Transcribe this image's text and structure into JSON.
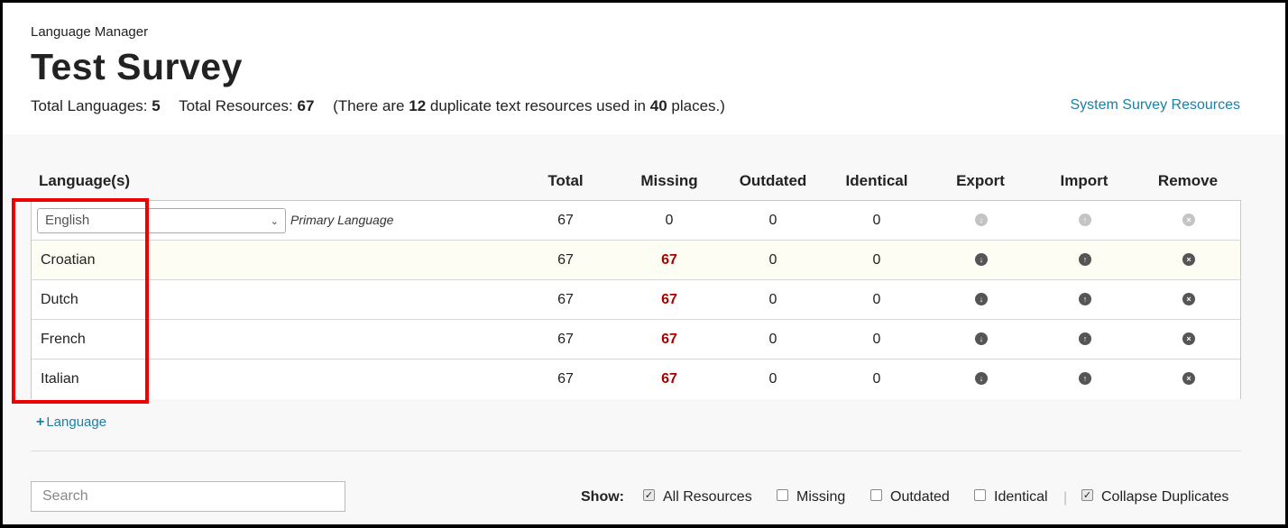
{
  "header": {
    "kicker": "Language Manager",
    "title": "Test Survey",
    "stats": {
      "total_languages_label": "Total Languages:",
      "total_languages_value": "5",
      "total_resources_label": "Total Resources:",
      "total_resources_value": "67",
      "dup_prefix": "(There are",
      "dup_count": "12",
      "dup_middle": "duplicate text resources used in",
      "dup_places": "40",
      "dup_suffix": "places.)"
    },
    "system_link": "System Survey Resources"
  },
  "table": {
    "columns": {
      "language": "Language(s)",
      "total": "Total",
      "missing": "Missing",
      "outdated": "Outdated",
      "identical": "Identical",
      "export": "Export",
      "import": "Import",
      "remove": "Remove"
    },
    "primary": {
      "selected": "English",
      "tag": "Primary Language",
      "total": "67",
      "missing": "0",
      "outdated": "0",
      "identical": "0"
    },
    "rows": [
      {
        "name": "Croatian",
        "total": "67",
        "missing": "67",
        "outdated": "0",
        "identical": "0"
      },
      {
        "name": "Dutch",
        "total": "67",
        "missing": "67",
        "outdated": "0",
        "identical": "0"
      },
      {
        "name": "French",
        "total": "67",
        "missing": "67",
        "outdated": "0",
        "identical": "0"
      },
      {
        "name": "Italian",
        "total": "67",
        "missing": "67",
        "outdated": "0",
        "identical": "0"
      }
    ],
    "icons": {
      "export": "arrow-down-circle-icon",
      "import": "arrow-up-circle-icon",
      "remove": "x-circle-icon"
    }
  },
  "add_language": "Language",
  "search": {
    "placeholder": "Search",
    "value": ""
  },
  "filters": {
    "label": "Show:",
    "options": [
      {
        "label": "All Resources",
        "checked": true
      },
      {
        "label": "Missing",
        "checked": false
      },
      {
        "label": "Outdated",
        "checked": false
      },
      {
        "label": "Identical",
        "checked": false
      },
      {
        "label": "Collapse Duplicates",
        "checked": true
      }
    ]
  },
  "colors": {
    "link": "#1a7fa6",
    "missing_red": "#aa0000",
    "highlight": "#ee0000"
  }
}
